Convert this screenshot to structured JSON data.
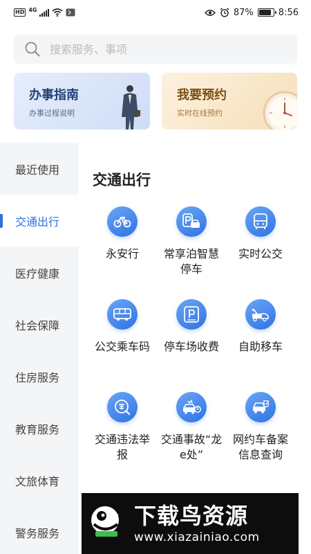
{
  "status_bar": {
    "hd": "HD",
    "network": "4G",
    "battery_text": "87%",
    "battery_level": 0.87,
    "time": "8:56"
  },
  "search": {
    "placeholder": "搜索服务、事项"
  },
  "banners": [
    {
      "title": "办事指南",
      "subtitle": "办事过程说明"
    },
    {
      "title": "我要预约",
      "subtitle": "实时在线预约"
    }
  ],
  "sidebar": {
    "items": [
      {
        "label": "最近使用"
      },
      {
        "label": "交通出行"
      },
      {
        "label": "医疗健康"
      },
      {
        "label": "社会保障"
      },
      {
        "label": "住房服务"
      },
      {
        "label": "教育服务"
      },
      {
        "label": "文旅体育"
      },
      {
        "label": "警务服务"
      }
    ],
    "active_index": 1
  },
  "main": {
    "section_title": "交通出行",
    "services": [
      {
        "label": "永安行",
        "icon": "bicycle-icon"
      },
      {
        "label": "常享泊智慧停车",
        "icon": "parking-car-icon"
      },
      {
        "label": "实时公交",
        "icon": "bus-icon"
      },
      {
        "label": "公交乘车码",
        "icon": "bus-code-icon"
      },
      {
        "label": "停车场收费",
        "icon": "parking-fee-icon"
      },
      {
        "label": "自助移车",
        "icon": "tow-truck-icon"
      },
      {
        "label": "交通违法举报",
        "icon": "violation-report-icon"
      },
      {
        "label": "交通事故“龙e处”",
        "icon": "accident-car-icon"
      },
      {
        "label": "网约车备案信息查询",
        "icon": "ride-hailing-query-icon"
      }
    ]
  },
  "watermark": {
    "title": "下载鸟资源",
    "url": "www.xiazainiao.com"
  },
  "colors": {
    "accent": "#2f6fe0",
    "icon_gradient_start": "#6aa6f5",
    "icon_gradient_end": "#2f73e3"
  }
}
